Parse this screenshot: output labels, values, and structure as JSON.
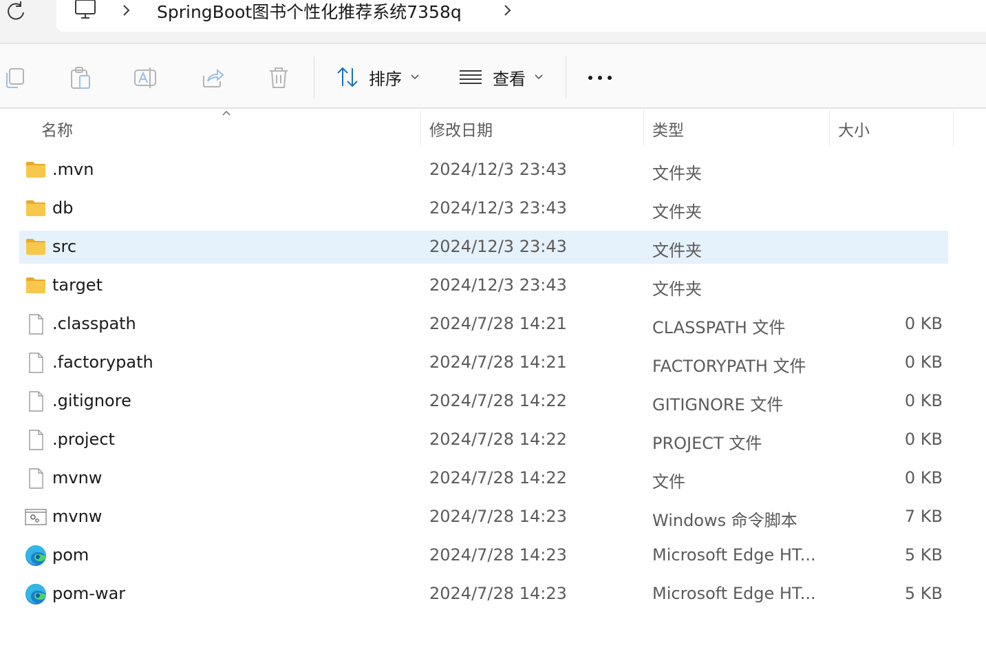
{
  "address": {
    "location_icon": "pc-icon",
    "path": "SpringBoot图书个性化推荐系统7358q"
  },
  "toolbar": {
    "icons": [
      "copy-icon",
      "paste-icon",
      "rename-icon",
      "share-icon",
      "delete-icon"
    ],
    "sort_label": "排序",
    "view_label": "查看",
    "more_label": "•••"
  },
  "columns": {
    "name": "名称",
    "modified": "修改日期",
    "type": "类型",
    "size": "大小"
  },
  "rows": [
    {
      "icon": "folder-icon",
      "name": ".mvn",
      "date": "2024/12/3 23:43",
      "type": "文件夹",
      "size": "",
      "selected": false
    },
    {
      "icon": "folder-icon",
      "name": "db",
      "date": "2024/12/3 23:43",
      "type": "文件夹",
      "size": "",
      "selected": false
    },
    {
      "icon": "folder-icon",
      "name": "src",
      "date": "2024/12/3 23:43",
      "type": "文件夹",
      "size": "",
      "selected": true
    },
    {
      "icon": "folder-icon",
      "name": "target",
      "date": "2024/12/3 23:43",
      "type": "文件夹",
      "size": "",
      "selected": false
    },
    {
      "icon": "file-icon",
      "name": ".classpath",
      "date": "2024/7/28 14:21",
      "type": "CLASSPATH 文件",
      "size": "0 KB",
      "selected": false
    },
    {
      "icon": "file-icon",
      "name": ".factorypath",
      "date": "2024/7/28 14:21",
      "type": "FACTORYPATH 文件",
      "size": "0 KB",
      "selected": false
    },
    {
      "icon": "file-icon",
      "name": ".gitignore",
      "date": "2024/7/28 14:22",
      "type": "GITIGNORE 文件",
      "size": "0 KB",
      "selected": false
    },
    {
      "icon": "file-icon",
      "name": ".project",
      "date": "2024/7/28 14:22",
      "type": "PROJECT 文件",
      "size": "0 KB",
      "selected": false
    },
    {
      "icon": "file-icon",
      "name": "mvnw",
      "date": "2024/7/28 14:22",
      "type": "文件",
      "size": "0 KB",
      "selected": false
    },
    {
      "icon": "script-icon",
      "name": "mvnw",
      "date": "2024/7/28 14:23",
      "type": "Windows 命令脚本",
      "size": "7 KB",
      "selected": false
    },
    {
      "icon": "edge-icon",
      "name": "pom",
      "date": "2024/7/28 14:23",
      "type": "Microsoft Edge HT...",
      "size": "5 KB",
      "selected": false
    },
    {
      "icon": "edge-icon",
      "name": "pom-war",
      "date": "2024/7/28 14:23",
      "type": "Microsoft Edge HT...",
      "size": "5 KB",
      "selected": false
    }
  ],
  "colors": {
    "selected_row": "#e5f1fb",
    "folder": "#f8c84a",
    "accent": "#1a6fc0"
  }
}
